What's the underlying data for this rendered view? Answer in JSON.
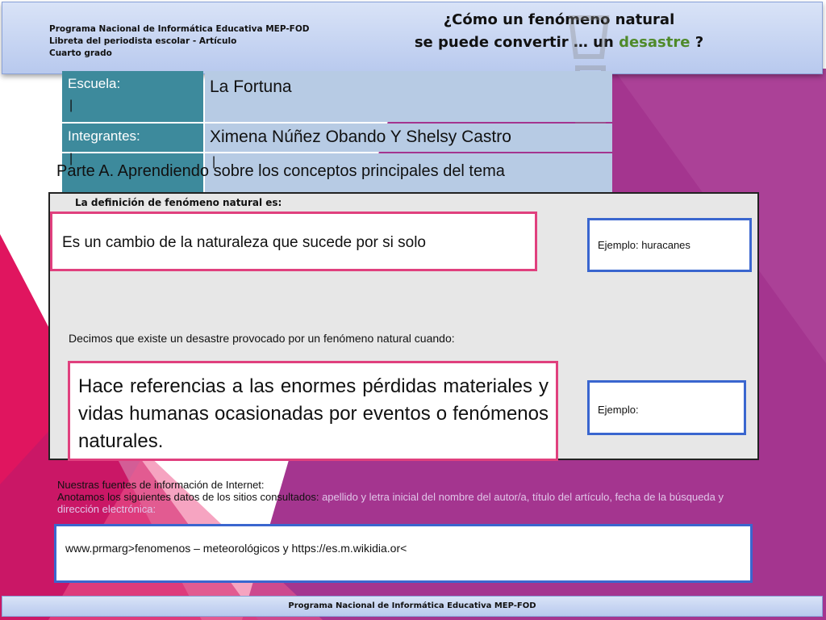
{
  "header": {
    "program": "Programa Nacional de Informática Educativa MEP-FOD",
    "notebook": "Libreta del periodista escolar -  Artículo",
    "grade": "Cuarto grado",
    "title_line1": "¿Cómo un fenómeno natural",
    "title_line2_prefix": "se puede convertir  … un ",
    "title_line2_accent": "desastre",
    "title_line2_suffix": " ?"
  },
  "info": {
    "school_label": "Escuela:",
    "school_value": "La Fortuna",
    "members_label": "Integrantes:",
    "members_value": "Ximena Núñez Obando Y Shelsy Castro",
    "cursor": "|"
  },
  "part_a": "Parte A.  Aprendiendo sobre los conceptos principales del tema",
  "definition": {
    "label": "La definición de  fenómeno natural es:",
    "text": "Es  un cambio de la naturaleza que sucede por si solo",
    "example": "Ejemplo:  huracanes"
  },
  "disaster": {
    "label": "Decimos que existe un desastre provocado por un fenómeno natural cuando:",
    "text": "Hace referencias a las enormes pérdidas materiales y vidas humanas  ocasionadas por eventos o fenómenos naturales.",
    "example": "Ejemplo:"
  },
  "sources": {
    "heading": "Nuestras fuentes de información de Internet:",
    "instruction": "Anotamos los siguientes datos de los sitios consultados: ",
    "instruction_faint": "apellido y letra inicial del nombre del autor/a,  título del artículo, fecha de la búsqueda y dirección electrónica:",
    "urls": "www.prmarg>fenomenos – meteorológicos   y   https://es.m.wikidia.or<"
  },
  "footer": "Programa Nacional de Informática  Educativa MEP-FOD",
  "colors": {
    "purple": "#a4358f",
    "magenta": "#e0155f",
    "teal_label": "#3d8a9c",
    "value_blue": "#b7cbe4",
    "accent_green": "#4f8a2a"
  }
}
